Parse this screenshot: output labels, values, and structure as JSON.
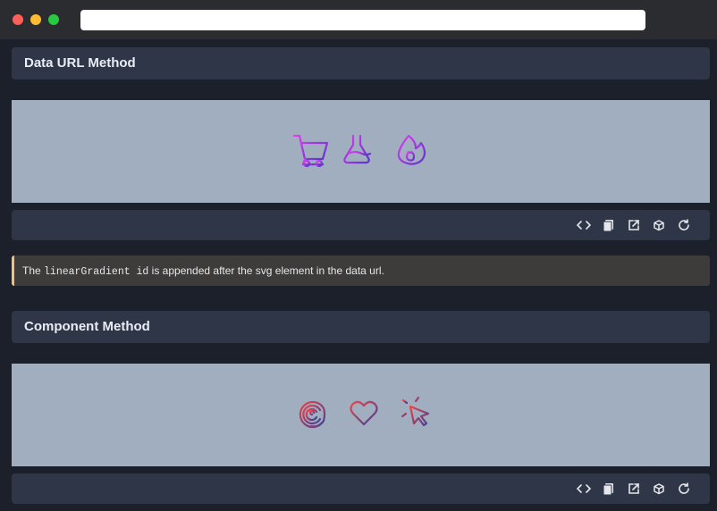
{
  "browser": {
    "url": ""
  },
  "sections": [
    {
      "title": "Data URL Method",
      "icons": [
        "shopping-cart-icon",
        "flask-icon",
        "flame-icon"
      ]
    },
    {
      "title": "Component Method",
      "icons": [
        "fingerprint-icon",
        "heart-icon",
        "cursor-click-icon"
      ]
    }
  ],
  "note": {
    "prefix": "The ",
    "code": "linearGradient id",
    "suffix": " is appended after the svg element in the data url."
  },
  "toolbar_icons": [
    "code-icon",
    "copy-icon",
    "external-link-icon",
    "box-icon",
    "refresh-icon"
  ],
  "colors": {
    "gradient_a": [
      "#d946ef",
      "#6d28d9"
    ],
    "gradient_b": [
      "#ef4444",
      "#3b3b98"
    ],
    "preview_bg": "#a0aec0",
    "panel_bg": "#2e3648",
    "note_border": "#f6c177"
  }
}
